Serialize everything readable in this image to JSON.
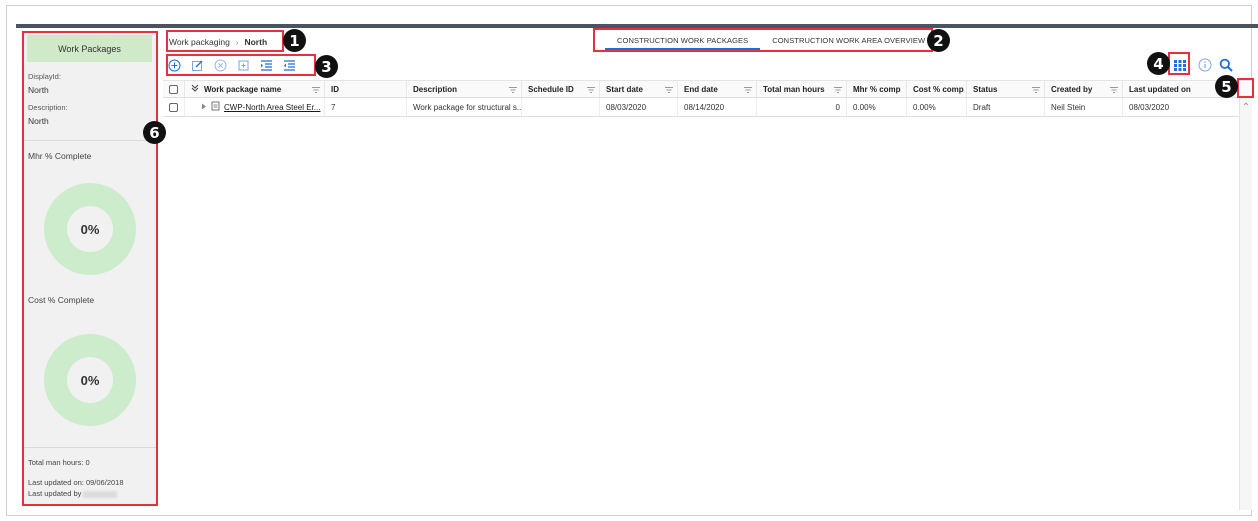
{
  "breadcrumb": {
    "root": "Work packaging",
    "separator": "›",
    "current": "North"
  },
  "tabs": [
    {
      "label": "CONSTRUCTION WORK PACKAGES",
      "active": true
    },
    {
      "label": "CONSTRUCTION WORK AREA OVERVIEW",
      "active": false
    }
  ],
  "sidebar": {
    "title": "Work Packages",
    "display_id_label": "DisplayId:",
    "display_id_value": "North",
    "description_label": "Description:",
    "description_value": "North",
    "mhr_label": "Mhr % Complete",
    "mhr_value": "0%",
    "cost_label": "Cost % Complete",
    "cost_value": "0%",
    "total_man_hours": "Total man hours: 0",
    "last_updated_on": "Last updated on: 09/06/2018",
    "last_updated_by": "Last updated by"
  },
  "toolbar": {
    "icons": [
      "add-icon",
      "edit-icon",
      "delete-icon",
      "copy-icon",
      "indent-icon",
      "outdent-icon"
    ]
  },
  "grid": {
    "columns": [
      "Work package name",
      "ID",
      "Description",
      "Schedule ID",
      "Start date",
      "End date",
      "Total man hours",
      "Mhr % comp",
      "Cost % comp",
      "Status",
      "Created by",
      "Last updated on"
    ],
    "rows": [
      {
        "name": "CWP-North Area Steel Er...",
        "id": "7",
        "description": "Work package for structural s...",
        "schedule_id": "",
        "start_date": "08/03/2020",
        "end_date": "08/14/2020",
        "total_man_hours": "0",
        "mhr_comp": "0.00%",
        "cost_comp": "0.00%",
        "status": "Draft",
        "created_by": "Neil Stein",
        "last_updated_on": "08/03/2020"
      }
    ]
  },
  "badges": [
    "1",
    "2",
    "3",
    "4",
    "5",
    "6"
  ],
  "colors": {
    "accent": "#1e6fd9",
    "highlight": "#e0333d",
    "donut": "#cdeccc",
    "sidebar_head": "#cfe9c9"
  }
}
